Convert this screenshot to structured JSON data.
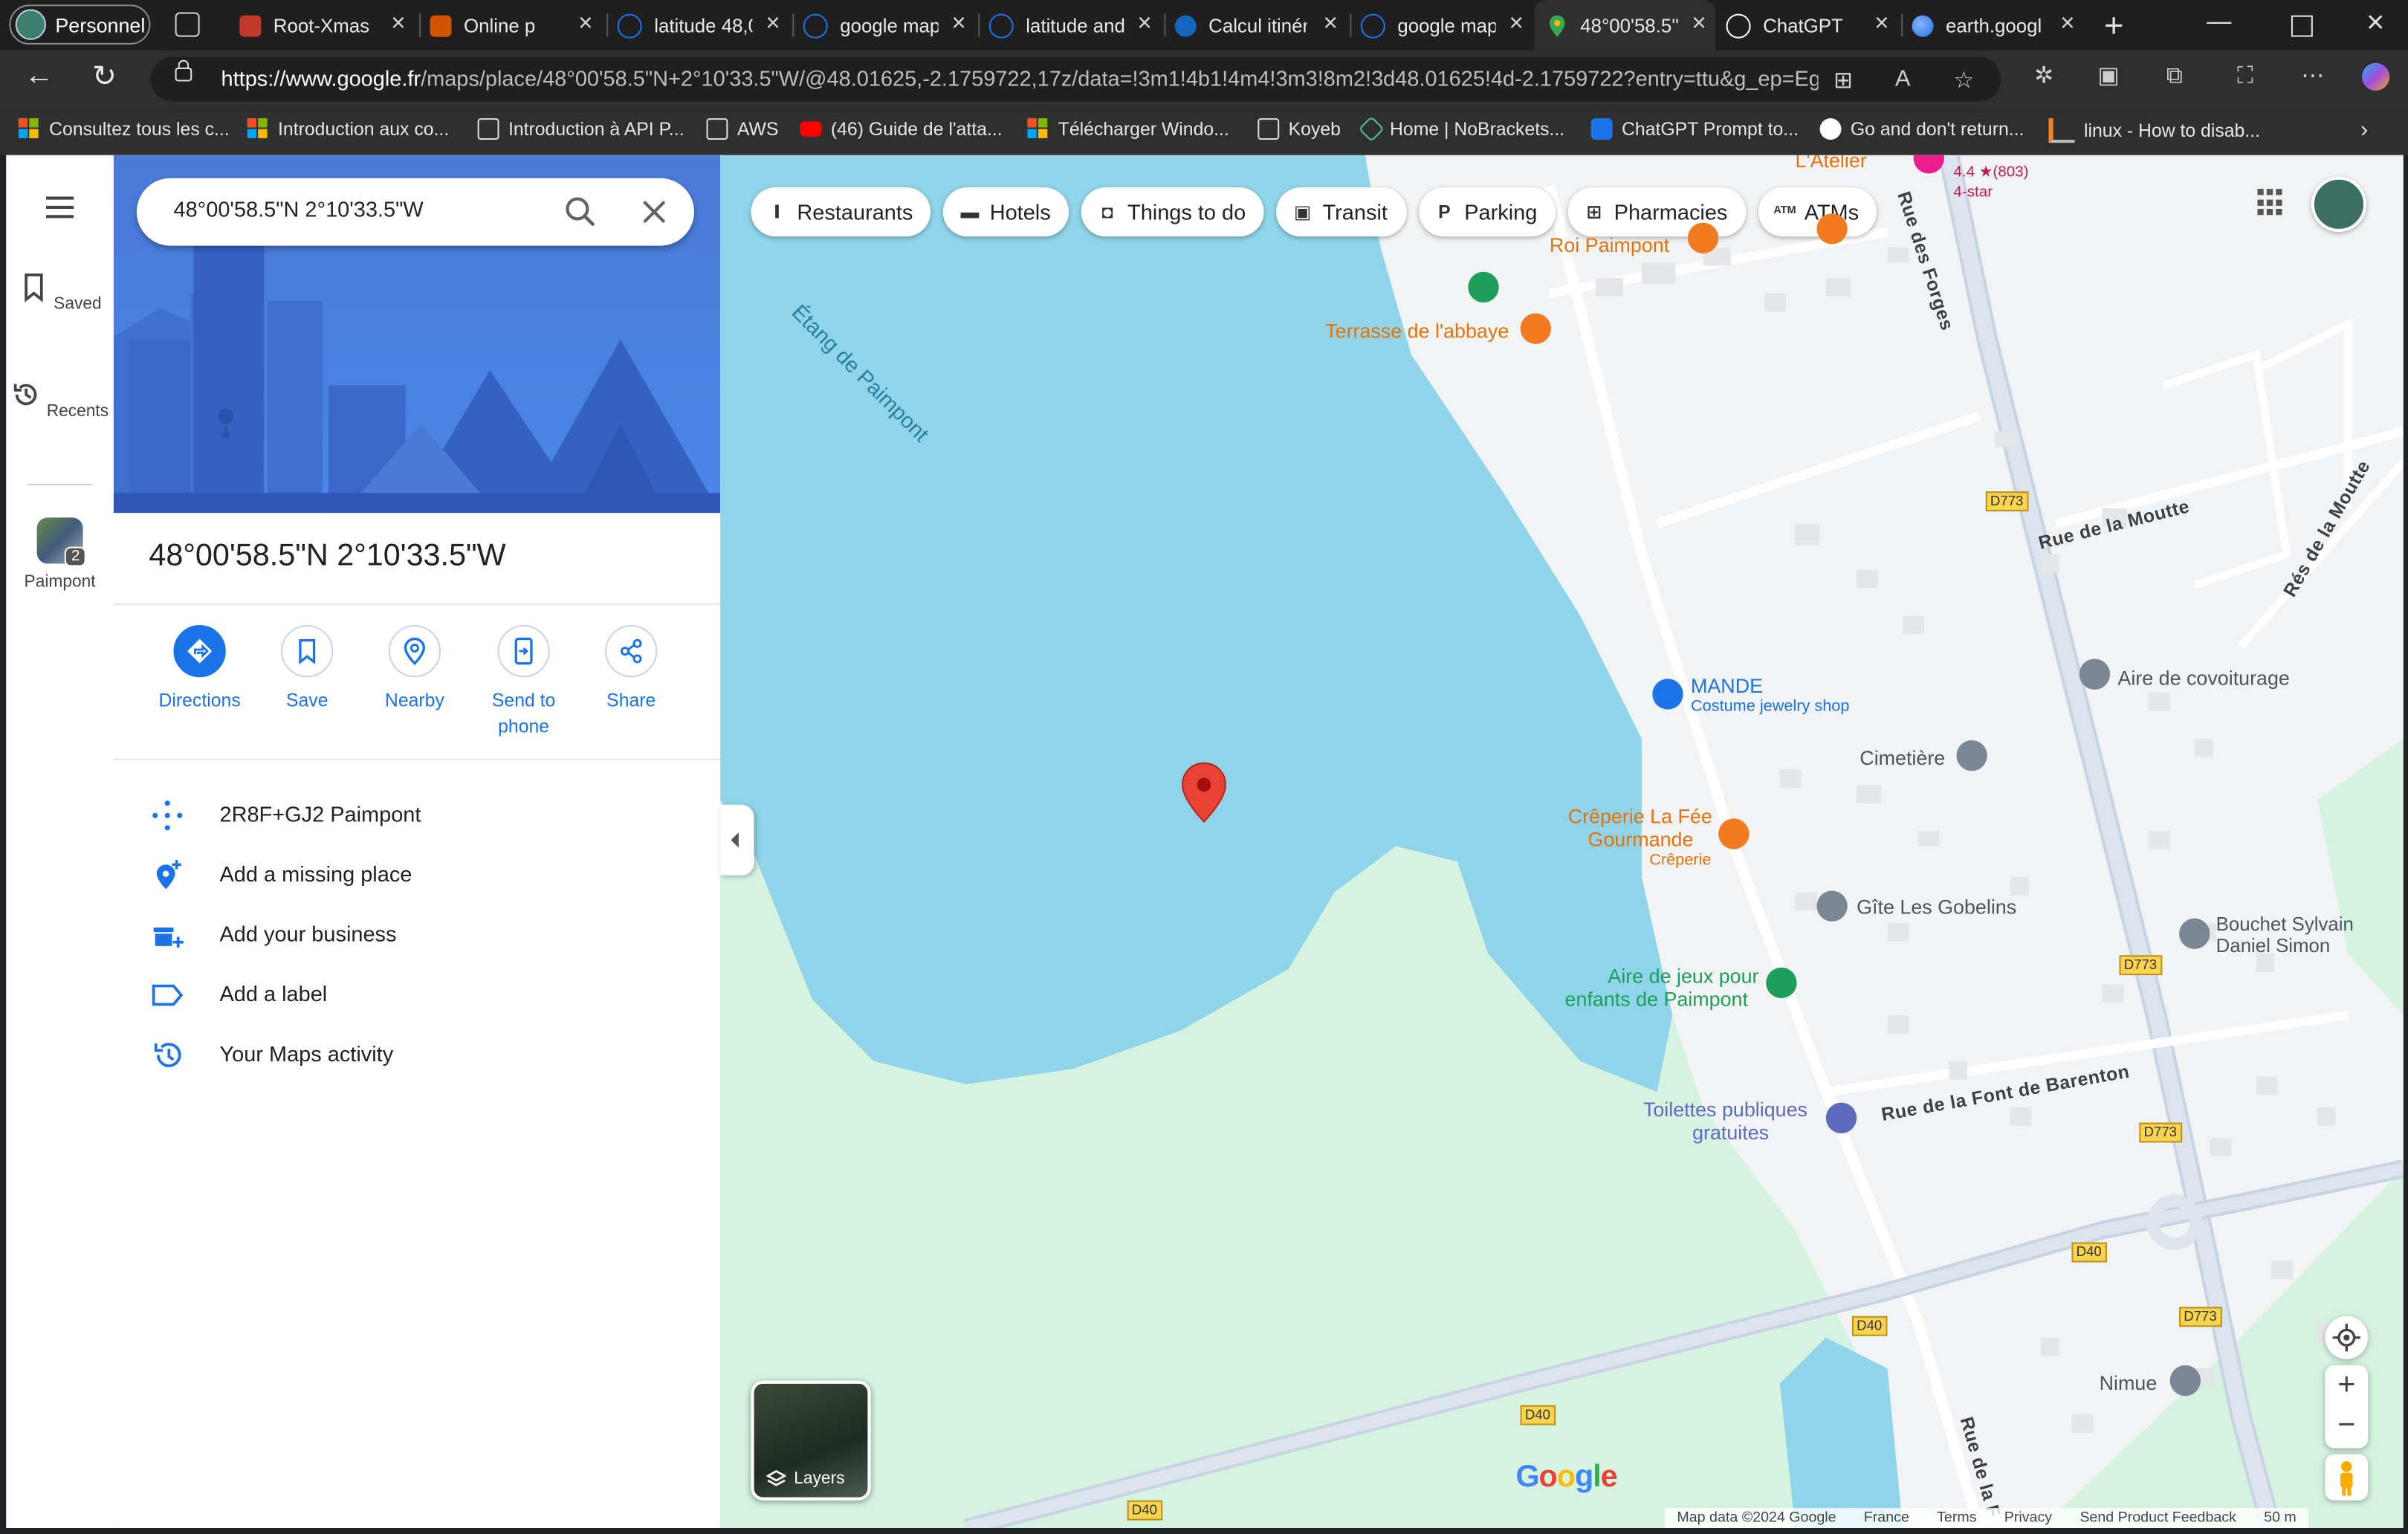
{
  "browser": {
    "profile_label": "Personnel",
    "tabs": [
      {
        "label": "Root-Xmas",
        "fav_color": "#c0392b"
      },
      {
        "label": "Online p",
        "fav_color": "#d35400"
      },
      {
        "label": "latitude 48,0",
        "fav_color": "#1a73e8"
      },
      {
        "label": "google map",
        "fav_color": "#1a73e8"
      },
      {
        "label": "latitude and",
        "fav_color": "#1a73e8"
      },
      {
        "label": "Calcul itinér",
        "fav_color": "#1565c0"
      },
      {
        "label": "google map",
        "fav_color": "#1a73e8"
      },
      {
        "label": "48°00'58.5''",
        "fav_color": "#34a853"
      },
      {
        "label": "ChatGPT",
        "fav_color": "#ffffff"
      },
      {
        "label": "earth.googl",
        "fav_color": "#4285f4"
      }
    ],
    "url_host": "https://www.google.fr",
    "url_rest": "/maps/place/48°00'58.5\"N+2°10'33.5\"W/@48.01625,-2.1759722,17z/data=!3m1!4b1!4m4!3m3!8m2!3d48.01625!4d-2.1759722?entry=ttu&g_ep=Ego...",
    "bookmarks": [
      {
        "label": "Consultez tous les c...",
        "icon": "microsoft-icon"
      },
      {
        "label": "Introduction aux co...",
        "icon": "microsoft-icon"
      },
      {
        "label": "Introduction à API P...",
        "icon": "page-icon"
      },
      {
        "label": "AWS",
        "icon": "page-icon"
      },
      {
        "label": "(46) Guide de l'atta...",
        "icon": "youtube-icon"
      },
      {
        "label": "Télécharger Windo...",
        "icon": "microsoft-icon"
      },
      {
        "label": "Koyeb",
        "icon": "page-icon"
      },
      {
        "label": "Home | NoBrackets...",
        "icon": "shield-icon"
      },
      {
        "label": "ChatGPT Prompt to...",
        "icon": "sparkle-icon"
      },
      {
        "label": "Go and don't return...",
        "icon": "github-icon"
      },
      {
        "label": "linux - How to disab...",
        "icon": "stack-icon"
      }
    ]
  },
  "sidebar_rail": {
    "saved": "Saved",
    "recents": "Recents",
    "recent_place": "Paimpont",
    "recent_count": "2"
  },
  "search": {
    "query": "48°00'58.5\"N 2°10'33.5\"W"
  },
  "place": {
    "title": "48°00'58.5\"N 2°10'33.5\"W",
    "actions": {
      "directions": "Directions",
      "save": "Save",
      "nearby": "Nearby",
      "send_to_phone_line1": "Send to",
      "send_to_phone_line2": "phone",
      "share": "Share"
    },
    "rows": {
      "plus_code": "2R8F+GJ2 Paimpont",
      "add_missing_place": "Add a missing place",
      "add_business": "Add your business",
      "add_label": "Add a label",
      "maps_activity": "Your Maps activity"
    }
  },
  "map": {
    "chips": {
      "restaurants": "Restaurants",
      "hotels": "Hotels",
      "things_to_do": "Things to do",
      "transit": "Transit",
      "parking": "Parking",
      "pharmacies": "Pharmacies",
      "atms": "ATMs"
    },
    "labels": {
      "lake": "Étang de Paimpont",
      "latelier": "L'Atelier",
      "rating": "4.4 ★(803)",
      "rating_sub": "4-star",
      "roi_paimpont": "Roi Paimpont",
      "terrasse": "Terrasse de l'abbaye",
      "rue_forges": "Rue des Forges",
      "rue_moutte": "Rue de la Moutte",
      "res_moutte": "Rés de la Moutte",
      "mande": "MANDE",
      "mande_sub": "Costume jewelry shop",
      "covoit": "Aire de covoiturage",
      "cimetiere": "Cimetière",
      "creperie1": "Crêperie La Fée",
      "creperie2": "Gourmande",
      "creperie_sub": "Crêperie",
      "gobelins": "Gîte Les Gobelins",
      "bouchet1": "Bouchet Sylvain",
      "bouchet2": "Daniel Simon",
      "jeux1": "Aire de jeux pour",
      "jeux2": "enfants de Paimpont",
      "toilettes1": "Toilettes publiques",
      "toilettes2": "gratuites",
      "font_barenton": "Rue de la Font de Barenton",
      "nimue": "Nimue",
      "rue_de_la_f": "Rue de la F"
    },
    "road_badges": {
      "d773": "D773",
      "d40": "D40"
    },
    "layers_label": "Layers",
    "google": "Google",
    "attribution": {
      "map_data": "Map data ©2024 Google",
      "country": "France",
      "terms": "Terms",
      "privacy": "Privacy",
      "feedback": "Send Product Feedback",
      "scale": "50 m"
    }
  },
  "colors": {
    "water": "#8fd4e8",
    "park": "#d6f3e2",
    "pin": "#ea4335",
    "food_poi": "#f27b22",
    "green_poi": "#1e9e5b",
    "blue_link": "#1a73e8"
  }
}
